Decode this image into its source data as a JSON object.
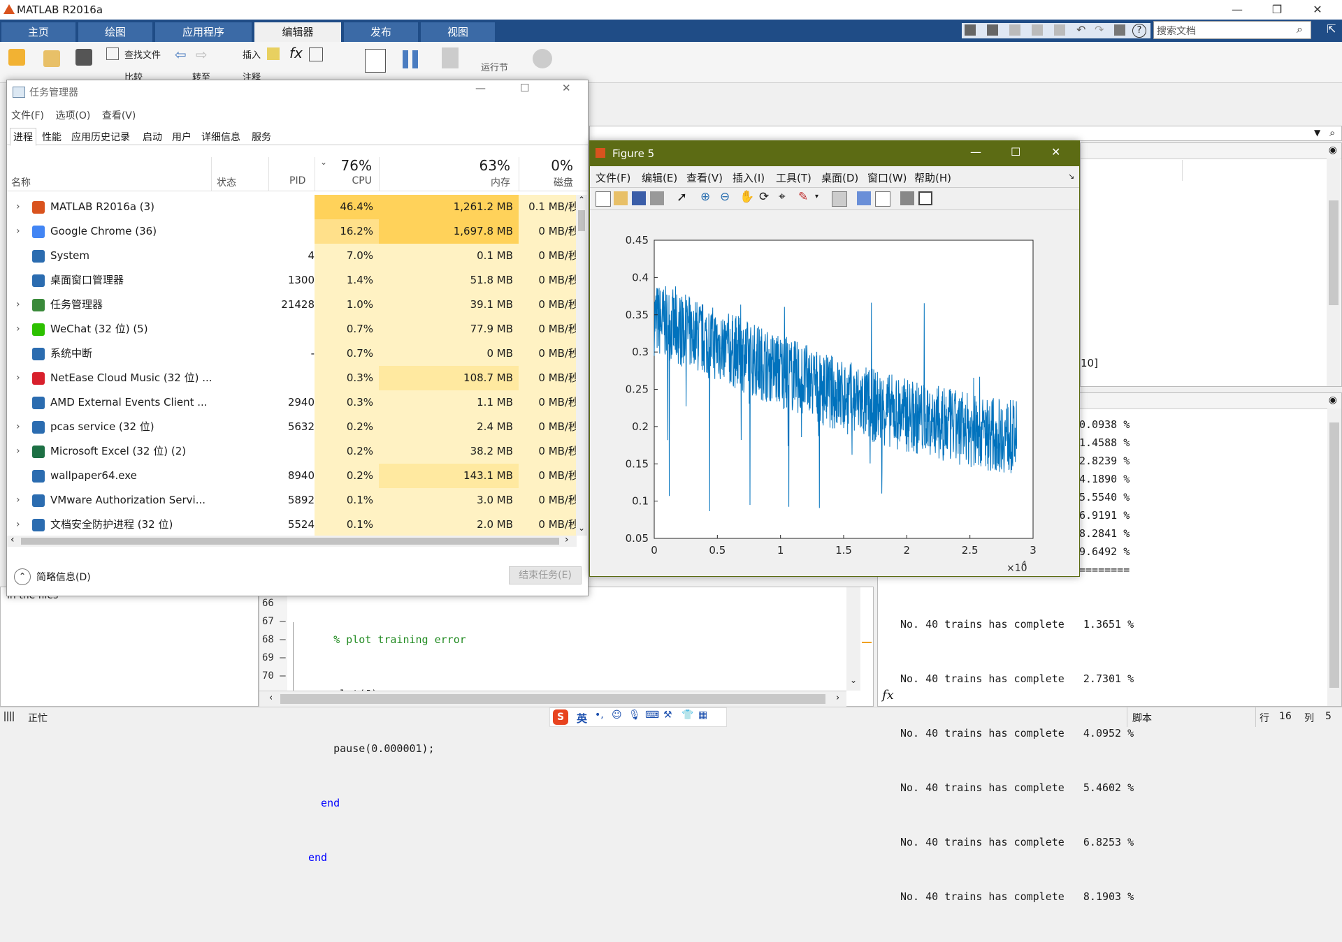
{
  "matlab": {
    "window_title": "MATLAB R2016a",
    "tabs": [
      "主页",
      "绘图",
      "应用程序",
      "编辑器",
      "发布",
      "视图"
    ],
    "active_tab": "编辑器",
    "search_placeholder": "搜索文档",
    "ribbon": {
      "find_files": "查找文件",
      "compare": "比较",
      "goto": "转至",
      "insert": "插入",
      "comment": "注释",
      "run_section": "运行节"
    },
    "status": {
      "busy": "正忙",
      "mode": "脚本",
      "row_label": "行",
      "row": "16",
      "col_label": "列",
      "col": "5"
    },
    "left_panel_text": "in the files",
    "editor": {
      "lines": [
        {
          "num": "66",
          "code": "    % plot training error",
          "is_comment": true
        },
        {
          "num": "67 —",
          "code": "    plot(J);",
          "is_comment": false
        },
        {
          "num": "68 —",
          "code": "    pause(0.000001);",
          "is_comment": false
        },
        {
          "num": "69 —",
          "code": "  end",
          "is_comment": false,
          "is_keyword": true
        },
        {
          "num": "70 —",
          "code": "end",
          "is_comment": false,
          "is_keyword": true
        }
      ]
    },
    "workspace_partial": "10]",
    "command_window": {
      "partial_lines": [
        "0.0938 %",
        "1.4588 %",
        "2.8239 %",
        "4.1890 %",
        "5.5540 %",
        "6.9191 %",
        "8.2841 %",
        "9.6492 %",
        "========"
      ],
      "full_lines": [
        "No. 40 trains has complete   1.3651 %",
        "No. 40 trains has complete   2.7301 %",
        "No. 40 trains has complete   4.0952 %",
        "No. 40 trains has complete   5.4602 %",
        "No. 40 trains has complete   6.8253 %",
        "No. 40 trains has complete   8.1903 %"
      ],
      "fx_symbol": "fx"
    },
    "ime": {
      "lang": "英"
    }
  },
  "task_manager": {
    "title": "任务管理器",
    "menu": [
      "文件(F)",
      "选项(O)",
      "查看(V)"
    ],
    "tabs": [
      "进程",
      "性能",
      "应用历史记录",
      "启动",
      "用户",
      "详细信息",
      "服务"
    ],
    "active_tab": "进程",
    "headers": {
      "name": "名称",
      "status": "状态",
      "pid": "PID",
      "cpu_pct": "76%",
      "cpu": "CPU",
      "mem_pct": "63%",
      "mem": "内存",
      "disk_pct": "0%",
      "disk": "磁盘"
    },
    "rows": [
      {
        "name": "MATLAB R2016a (3)",
        "pid": "",
        "cpu": "46.4%",
        "mem": "1,261.2 MB",
        "disk": "0.1 MB/秒",
        "expandable": true,
        "icon": "matlab-icon",
        "icon_color": "#d9531e"
      },
      {
        "name": "Google Chrome (36)",
        "pid": "",
        "cpu": "16.2%",
        "mem": "1,697.8 MB",
        "disk": "0 MB/秒",
        "expandable": true,
        "icon": "chrome-icon",
        "icon_color": "#4285f4"
      },
      {
        "name": "System",
        "pid": "4",
        "cpu": "7.0%",
        "mem": "0.1 MB",
        "disk": "0 MB/秒",
        "expandable": false,
        "icon": "window-icon",
        "icon_color": "#2b6cb0"
      },
      {
        "name": "桌面窗口管理器",
        "pid": "1300",
        "cpu": "1.4%",
        "mem": "51.8 MB",
        "disk": "0 MB/秒",
        "expandable": false,
        "icon": "window-icon",
        "icon_color": "#2b6cb0"
      },
      {
        "name": "任务管理器",
        "pid": "21428",
        "cpu": "1.0%",
        "mem": "39.1 MB",
        "disk": "0 MB/秒",
        "expandable": true,
        "icon": "taskmgr-icon",
        "icon_color": "#3a8a3a"
      },
      {
        "name": "WeChat (32 位) (5)",
        "pid": "",
        "cpu": "0.7%",
        "mem": "77.9 MB",
        "disk": "0 MB/秒",
        "expandable": true,
        "icon": "wechat-icon",
        "icon_color": "#2dc100"
      },
      {
        "name": "系统中断",
        "pid": "-",
        "cpu": "0.7%",
        "mem": "0 MB",
        "disk": "0 MB/秒",
        "expandable": false,
        "icon": "window-icon",
        "icon_color": "#2b6cb0"
      },
      {
        "name": "NetEase Cloud Music (32 位) ...",
        "pid": "",
        "cpu": "0.3%",
        "mem": "108.7 MB",
        "disk": "0 MB/秒",
        "expandable": true,
        "icon": "netease-icon",
        "icon_color": "#d8202c"
      },
      {
        "name": "AMD External Events Client ...",
        "pid": "2940",
        "cpu": "0.3%",
        "mem": "1.1 MB",
        "disk": "0 MB/秒",
        "expandable": false,
        "icon": "window-icon",
        "icon_color": "#2b6cb0"
      },
      {
        "name": "pcas service (32 位)",
        "pid": "5632",
        "cpu": "0.2%",
        "mem": "2.4 MB",
        "disk": "0 MB/秒",
        "expandable": true,
        "icon": "window-icon",
        "icon_color": "#2b6cb0"
      },
      {
        "name": "Microsoft Excel (32 位) (2)",
        "pid": "",
        "cpu": "0.2%",
        "mem": "38.2 MB",
        "disk": "0 MB/秒",
        "expandable": true,
        "icon": "excel-icon",
        "icon_color": "#1d7044"
      },
      {
        "name": "wallpaper64.exe",
        "pid": "8940",
        "cpu": "0.2%",
        "mem": "143.1 MB",
        "disk": "0 MB/秒",
        "expandable": false,
        "icon": "wallpaper-icon",
        "icon_color": "#2b6cb0"
      },
      {
        "name": "VMware Authorization Servi...",
        "pid": "5892",
        "cpu": "0.1%",
        "mem": "3.0 MB",
        "disk": "0 MB/秒",
        "expandable": true,
        "icon": "window-icon",
        "icon_color": "#2b6cb0"
      },
      {
        "name": "文档安全防护进程 (32 位)",
        "pid": "5524",
        "cpu": "0.1%",
        "mem": "2.0 MB",
        "disk": "0 MB/秒",
        "expandable": true,
        "icon": "window-icon",
        "icon_color": "#2b6cb0"
      }
    ],
    "footer": {
      "summary": "简略信息(D)",
      "end_task": "结束任务(E)"
    }
  },
  "figure": {
    "title": "Figure 5",
    "menu": [
      "文件(F)",
      "编辑(E)",
      "查看(V)",
      "插入(I)",
      "工具(T)",
      "桌面(D)",
      "窗口(W)",
      "帮助(H)"
    ],
    "exponent_label": "×10",
    "exponent_power": "4"
  },
  "chart_data": {
    "type": "line",
    "title": "",
    "xlabel": "",
    "ylabel": "",
    "xlim": [
      0,
      30000
    ],
    "ylim": [
      0.05,
      0.45
    ],
    "x_ticks": [
      "0",
      "0.5",
      "1",
      "1.5",
      "2",
      "2.5",
      "3"
    ],
    "y_ticks": [
      "0.05",
      "0.1",
      "0.15",
      "0.2",
      "0.25",
      "0.3",
      "0.35",
      "0.4",
      "0.45"
    ],
    "series": [
      {
        "color": "#0072bd",
        "x_range": [
          0,
          28700
        ],
        "trend": [
          [
            0,
            0.345
          ],
          [
            5000,
            0.31
          ],
          [
            10000,
            0.275
          ],
          [
            15000,
            0.24
          ],
          [
            20000,
            0.215
          ],
          [
            25000,
            0.195
          ],
          [
            28700,
            0.185
          ]
        ],
        "noise_band": 0.05,
        "spike_high": 0.42,
        "spike_low": 0.085
      }
    ],
    "grid": false
  }
}
